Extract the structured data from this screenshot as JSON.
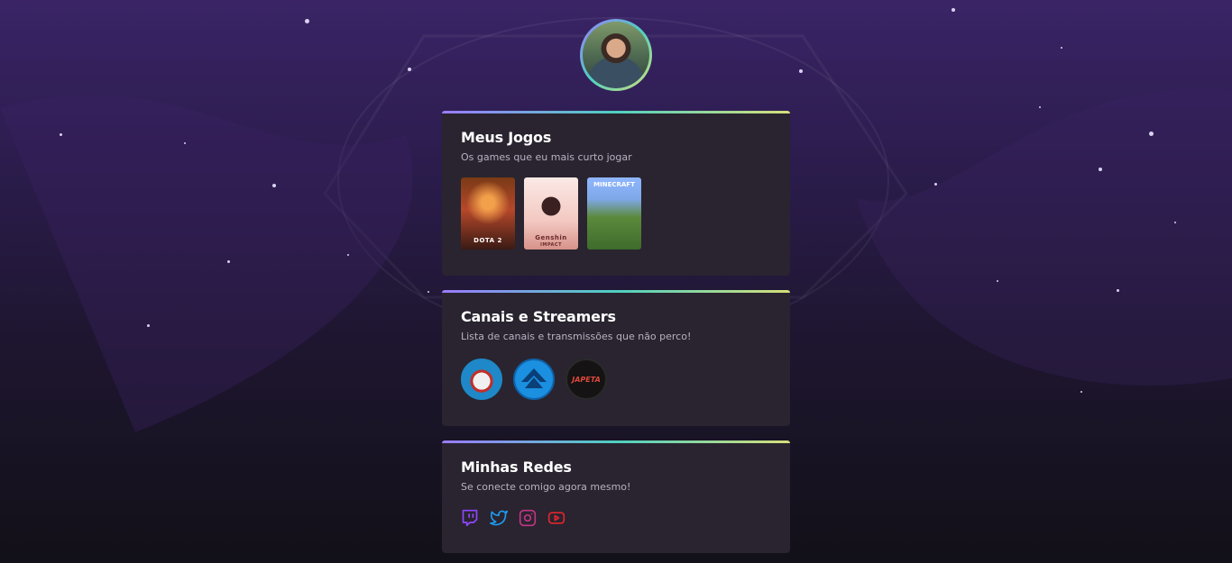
{
  "cards": [
    {
      "title": "Meus Jogos",
      "subtitle": "Os games que eu mais curto jogar",
      "games": [
        {
          "name": "DOTA 2"
        },
        {
          "name": "Genshin",
          "sub": "IMPACT"
        },
        {
          "name": "MINECRAFT"
        }
      ]
    },
    {
      "title": "Canais e Streamers",
      "subtitle": "Lista de canais e transmissões que não perco!",
      "streamers": [
        {
          "icon": "streamer-avatar-1"
        },
        {
          "icon": "streamer-avatar-2"
        },
        {
          "icon": "streamer-avatar-3",
          "label": "JAPETA"
        }
      ]
    },
    {
      "title": "Minhas Redes",
      "subtitle": "Se conecte comigo agora mesmo!",
      "socials": [
        {
          "icon": "twitch-icon",
          "color": "#9146ff"
        },
        {
          "icon": "twitter-icon",
          "color": "#1d9bf0"
        },
        {
          "icon": "instagram-icon",
          "color": "#c13584"
        },
        {
          "icon": "youtube-icon",
          "color": "#e0262e"
        }
      ]
    }
  ],
  "colors": {
    "card_bg": "#29242f",
    "accent_gradient": [
      "#9b7bff",
      "#4fd0c0",
      "#d6e07a"
    ]
  }
}
